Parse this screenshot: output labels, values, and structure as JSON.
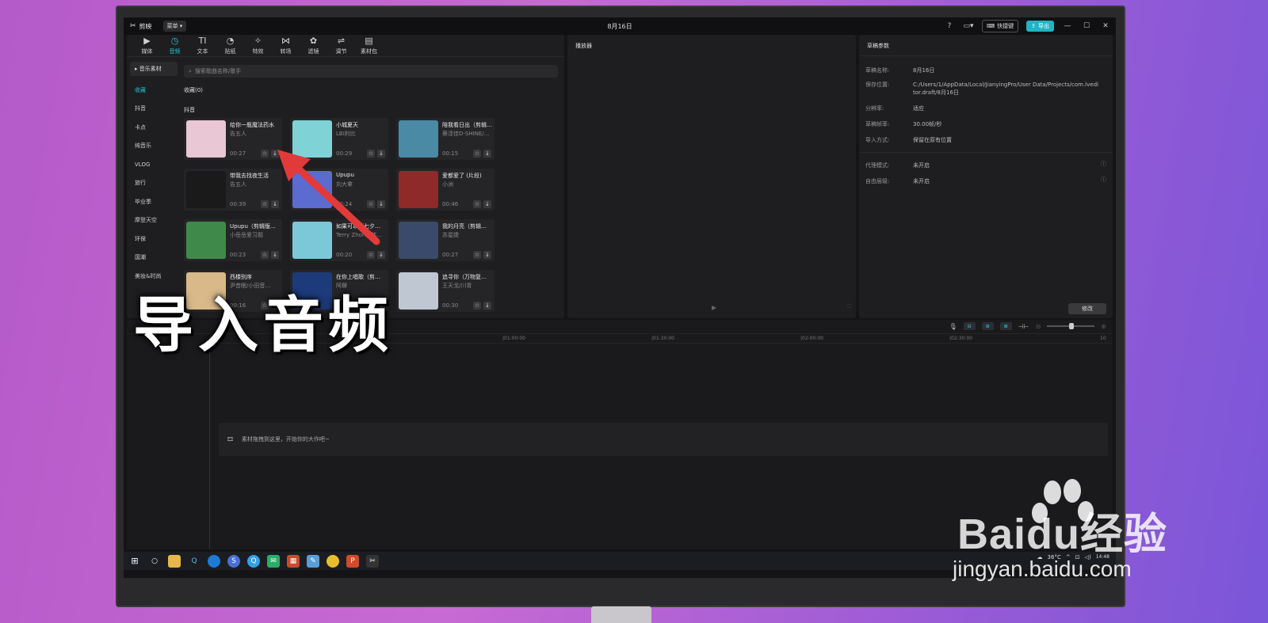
{
  "app": {
    "name": "剪映",
    "menu_label": "菜单",
    "doc_title": "8月16日",
    "shortcut_label": "快捷键",
    "export_label": "导出"
  },
  "toolbar": [
    "媒体",
    "音频",
    "文本",
    "贴纸",
    "特效",
    "转场",
    "滤镜",
    "调节",
    "素材包"
  ],
  "toolbar_icons": [
    "▶",
    "◷",
    "TI",
    "◔",
    "✧",
    "⋈",
    "✿",
    "⇌",
    "▤"
  ],
  "categories": {
    "head": "▸ 音乐素材",
    "items": [
      "收藏",
      "抖音",
      "卡点",
      "纯音乐",
      "VLOG",
      "旅行",
      "毕业季",
      "摩登天空",
      "环保",
      "国潮",
      "美妆&时尚"
    ]
  },
  "search": {
    "placeholder": "搜索歌曲名称/歌手"
  },
  "fav_label": "收藏(0)",
  "section_label": "抖音",
  "songs": [
    {
      "title": "给你一瓶魔法药水",
      "artist": "告五人",
      "duration": "00:27",
      "thumb": "#e9c7d4"
    },
    {
      "title": "小城夏天",
      "artist": "LBI利比",
      "duration": "00:29",
      "thumb": "#7fd3d6"
    },
    {
      "title": "陪我看日出（剪辑…",
      "artist": "蔡淳佳D-SHINE/…",
      "duration": "00:15",
      "thumb": "#4a8aa4"
    },
    {
      "title": "带我去找夜生活",
      "artist": "告五人",
      "duration": "00:39",
      "thumb": "#1a1a1a"
    },
    {
      "title": "Upupu",
      "artist": "刘大拿",
      "duration": "00:24",
      "thumb": "#5b6bd0"
    },
    {
      "title": "爱都爱了 (片段)",
      "artist": "小洲",
      "duration": "00:46",
      "thumb": "#8e2a2a"
    },
    {
      "title": "Upupu（剪辑版…",
      "artist": "小岳岳爱习题",
      "duration": "00:23",
      "thumb": "#3f8a4a"
    },
    {
      "title": "如果可以（七夕…",
      "artist": "Terry Zhong 韩…",
      "duration": "00:20",
      "thumb": "#7cc7d8"
    },
    {
      "title": "我的月亮（剪辑…",
      "artist": "苏星婕",
      "duration": "00:27",
      "thumb": "#3a4a6a"
    },
    {
      "title": "西楼别序",
      "artist": "尹昔眠/小田音…",
      "duration": "00:16",
      "thumb": "#d9b98a"
    },
    {
      "title": "在你上唱歌（剪…",
      "artist": "阿肆",
      "duration": "00:20",
      "thumb": "#1d3a7a"
    },
    {
      "title": "追寻你（万物复…",
      "artist": "王天戈/川青",
      "duration": "00:30",
      "thumb": "#bfc8d2"
    }
  ],
  "player": {
    "title": "播放器"
  },
  "draft": {
    "title": "草稿参数",
    "rows": [
      {
        "k": "草稿名称:",
        "v": "8月16日"
      },
      {
        "k": "保存位置:",
        "v": "C:/Users/1/AppData/Local/JianyingPro/User Data/Projects/com.lveditor.draft/8月16日"
      },
      {
        "k": "分辨率:",
        "v": "适应"
      },
      {
        "k": "草稿帧率:",
        "v": "30.00帧/秒"
      },
      {
        "k": "导入方式:",
        "v": "保留在原有位置"
      },
      {
        "k": "代理模式:",
        "v": "未开启"
      },
      {
        "k": "自由层级:",
        "v": "未开启"
      }
    ],
    "modify_label": "修改"
  },
  "timeline": {
    "ruler": [
      "00:00",
      "|01:00:00",
      "|01:30:00",
      "|02:00:00",
      "|02:30:00",
      "10"
    ],
    "drop_hint": "素材拖拽到这里，开始你的大作吧~"
  },
  "taskbar": {
    "weather": "36°C",
    "time": "14:48"
  },
  "overlay_title": "导入音频",
  "watermark": {
    "brand": "Baidu经验",
    "url": "jingyan.baidu.com"
  },
  "colors": {
    "accent": "#22c2d3",
    "export": "#1fb5c4",
    "bg": "#141416"
  }
}
